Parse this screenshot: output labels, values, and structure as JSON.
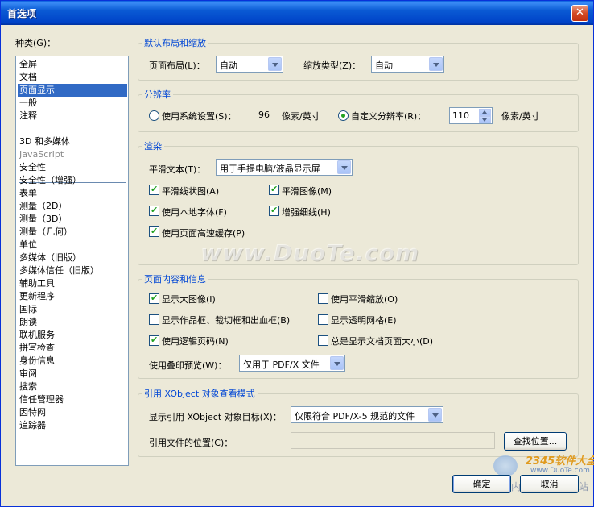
{
  "window": {
    "title": "首选项",
    "close_glyph": "✕"
  },
  "categories": {
    "label": "种类(G)：",
    "group1": [
      "全屏",
      "文档",
      "页面显示",
      "一般",
      "注释"
    ],
    "group2": [
      "3D 和多媒体",
      "JavaScript",
      "安全性",
      "安全性（增强）",
      "表单",
      "测量（2D）",
      "测量（3D）",
      "测量（几何）",
      "单位",
      "多媒体（旧版）",
      "多媒体信任（旧版）",
      "辅助工具",
      "更新程序",
      "国际",
      "朗读",
      "联机服务",
      "拼写检查",
      "身份信息",
      "审阅",
      "搜索",
      "信任管理器",
      "因特网",
      "追踪器"
    ],
    "selected": "页面显示"
  },
  "layout": {
    "title": "默认布局和缩放",
    "page_layout_label": "页面布局(L)：",
    "page_layout_value": "自动",
    "zoom_label": "缩放类型(Z)：",
    "zoom_value": "自动"
  },
  "resolution": {
    "title": "分辨率",
    "system_label": "使用系统设置(S)：",
    "system_value": "96",
    "system_unit": "像素/英寸",
    "custom_label": "自定义分辨率(R)：",
    "custom_value": "110",
    "custom_unit": "像素/英寸",
    "selected": "custom"
  },
  "rendering": {
    "title": "渲染",
    "smooth_text_label": "平滑文本(T)：",
    "smooth_text_value": "用于手提电脑/液晶显示屏",
    "smooth_line_art": "平滑线状图(A)",
    "smooth_images": "平滑图像(M)",
    "local_fonts": "使用本地字体(F)",
    "enhance_thin_lines": "增强细线(H)",
    "page_cache": "使用页面高速缓存(P)"
  },
  "page_content": {
    "title": "页面内容和信息",
    "show_large_images": "显示大图像(I)",
    "smooth_zoom": "使用平滑缩放(O)",
    "show_art_boxes": "显示作品框、裁切框和出血框(B)",
    "show_transparency_grid": "显示透明网格(E)",
    "logical_page_numbers": "使用逻辑页码(N)",
    "always_show_page_size": "总是显示文档页面大小(D)",
    "overprint_label": "使用叠印预览(W)：",
    "overprint_value": "仅用于 PDF/X 文件"
  },
  "xobject": {
    "title": "引用 XObject 对象查看模式",
    "show_target_label": "显示引用 XObject 对象目标(X)：",
    "show_target_value": "仅限符合 PDF/X-5 规范的文件",
    "file_location_label": "引用文件的位置(C)：",
    "file_location_value": "",
    "browse_button": "查找位置..."
  },
  "footer": {
    "ok": "确定",
    "cancel": "取消"
  },
  "watermarks": {
    "duote": "www.DuoTe.com",
    "brand": "2345软件大全",
    "site": "www.DuoTe.com",
    "slogan": "国内最安全的软件站"
  }
}
